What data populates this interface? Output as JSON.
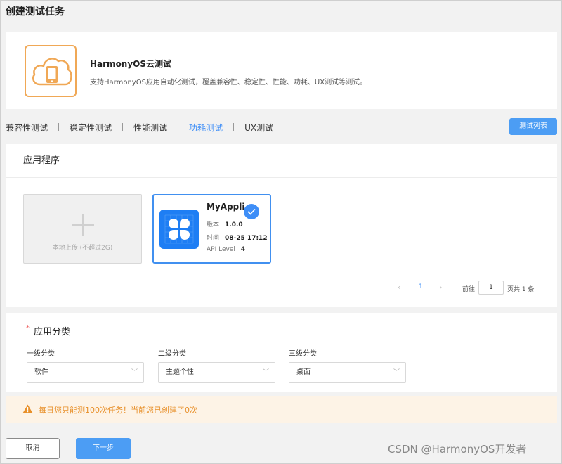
{
  "page": {
    "title": "创建测试任务"
  },
  "header": {
    "icon": "cloud-phone-icon",
    "title": "HarmonyOS云测试",
    "description": "支持HarmonyOS应用自动化测试，覆盖兼容性、稳定性、性能、功耗、UX测试等测试。"
  },
  "tabs": [
    {
      "label": "兼容性测试",
      "active": false
    },
    {
      "label": "稳定性测试",
      "active": false
    },
    {
      "label": "性能测试",
      "active": false
    },
    {
      "label": "功耗测试",
      "active": true
    },
    {
      "label": "UX测试",
      "active": false
    }
  ],
  "toolbar": {
    "list_button": "测试列表"
  },
  "app_section": {
    "title": "应用程序",
    "upload_label": "本地上传 (不超过2G)",
    "app": {
      "name": "MyAppli...",
      "version_label": "版本",
      "version": "1.0.0",
      "time_label": "时间",
      "time": "08-25 17:12",
      "api_label": "API Level",
      "api": "4",
      "selected": true
    },
    "pagination": {
      "prev": "‹",
      "current_page": "1",
      "next": "›",
      "goto_label": "前往",
      "goto_value": "1",
      "total_label": "页共 1 条"
    }
  },
  "category": {
    "title": "应用分类",
    "required_mark": "*",
    "level1_label": "一级分类",
    "level1_value": "软件",
    "level2_label": "二级分类",
    "level2_value": "主题个性",
    "level3_label": "三级分类",
    "level3_value": "桌面"
  },
  "warning": {
    "text": "每日您只能测100次任务！当前您已创建了0次"
  },
  "footer": {
    "cancel": "取消",
    "next": "下一步"
  },
  "watermark": "CSDN @HarmonyOS开发者",
  "colors": {
    "accent": "#3e8ef7",
    "warning": "#e8902a",
    "icon_orange": "#f0a856"
  }
}
